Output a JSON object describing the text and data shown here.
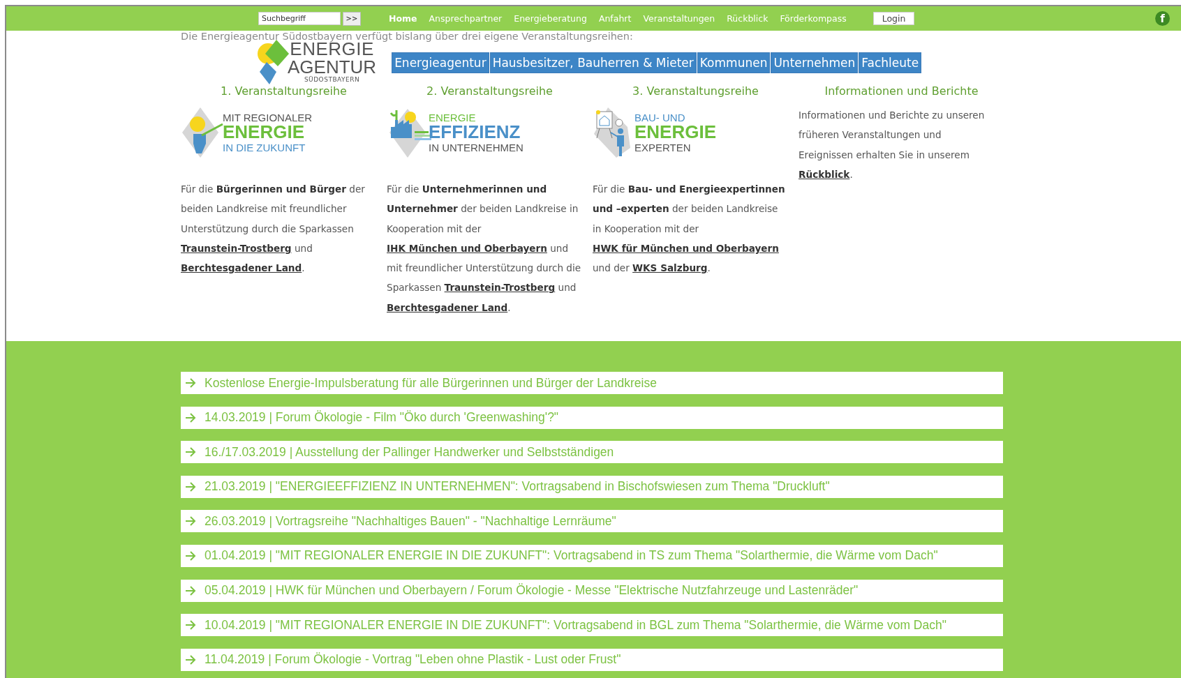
{
  "top_bar": {
    "search": {
      "placeholder": "Suchbegriff"
    },
    "search_button": ">>",
    "nav": [
      {
        "label": "Home",
        "selected": true
      },
      {
        "label": "Ansprechpartner",
        "selected": false
      },
      {
        "label": "Energieberatung",
        "selected": false
      },
      {
        "label": "Anfahrt",
        "selected": false
      },
      {
        "label": "Veranstaltungen",
        "selected": false
      },
      {
        "label": "Rückblick",
        "selected": false
      },
      {
        "label": "Förderkompass",
        "selected": false
      }
    ],
    "login": "Login",
    "facebook_glyph": "f"
  },
  "intro": "Die Energieagentur Südostbayern verfügt bislang über drei eigene Veranstaltungsreihen:",
  "logo": {
    "lines": [
      "ENERGIE",
      "AGENTUR",
      "SÜDOSTBAYERN"
    ]
  },
  "main_menu": [
    "Energieagentur",
    "Hausbesitzer, Bauherren & Mieter",
    "Kommunen",
    "Unternehmen",
    "Fachleute"
  ],
  "series_headings": [
    "1. Veranstaltungsreihe",
    "2. Veranstaltungsreihe",
    "3. Veranstaltungsreihe",
    "Informationen und Berichte"
  ],
  "columns": [
    {
      "kind": "hand",
      "logo_lines": [
        {
          "text": "MIT REGIONALER",
          "color": "#555555"
        },
        {
          "text": "ENERGIE",
          "color": "#6cbf3c"
        },
        {
          "text": "IN DIE ZUKUNFT",
          "color": "#4a90c8"
        }
      ],
      "text": [
        {
          "t": "Für die "
        },
        {
          "t": "Bürgerinnen und Bürger",
          "bold": true
        },
        {
          "t": " der beiden Landkreise mit freundlicher Unterstützung durch die Sparkassen "
        },
        {
          "t": "Traunstein-Trostberg",
          "link": true
        },
        {
          "t": " und "
        },
        {
          "t": "Berchtesgadener Land",
          "link": true
        },
        {
          "t": "."
        }
      ]
    },
    {
      "kind": "factory",
      "logo_lines": [
        {
          "text": "ENERGIE",
          "color": "#6cbf3c"
        },
        {
          "text": "EFFIZIENZ",
          "color": "#4a90c8"
        },
        {
          "text": "IN UNTERNEHMEN",
          "color": "#555555"
        }
      ],
      "text": [
        {
          "t": "Für die "
        },
        {
          "t": "Unternehmerinnen und Unternehmer",
          "bold": true
        },
        {
          "t": " der beiden Landkreise in Kooperation mit der "
        },
        {
          "t": "IHK München und Oberbayern",
          "link": true
        },
        {
          "t": " und mit freundlicher Unterstützung durch die Sparkassen "
        },
        {
          "t": "Traunstein-Trostberg",
          "link": true
        },
        {
          "t": " und "
        },
        {
          "t": "Berchtesgadener Land",
          "link": true
        },
        {
          "t": "."
        }
      ]
    },
    {
      "kind": "expert",
      "logo_lines": [
        {
          "text": "BAU- UND",
          "color": "#4a90c8"
        },
        {
          "text": "ENERGIE",
          "color": "#6cbf3c"
        },
        {
          "text": "EXPERTEN",
          "color": "#555555"
        }
      ],
      "text": [
        {
          "t": "Für die "
        },
        {
          "t": "Bau- und Energieexpertinnen und –experten",
          "bold": true
        },
        {
          "t": " der beiden Landkreise in Kooperation mit der "
        },
        {
          "t": "HWK für München und Oberbayern",
          "link": true
        },
        {
          "t": " und der "
        },
        {
          "t": "WKS Salzburg",
          "link": true
        },
        {
          "t": "."
        }
      ]
    },
    {
      "kind": "info",
      "text": [
        {
          "t": "Informationen und Berichte zu unseren früheren Veranstaltungen und Ereignissen erhalten Sie in unserem "
        },
        {
          "t": "Rückblick",
          "link": true
        },
        {
          "t": "."
        }
      ]
    }
  ],
  "events": [
    "Kostenlose Energie-Impulsberatung für alle Bürgerinnen und Bürger der Landkreise",
    "14.03.2019 | Forum Ökologie - Film \"Öko durch 'Greenwashing'?\"",
    "16./17.03.2019 | Ausstellung der Pallinger Handwerker und Selbstständigen",
    "21.03.2019 | \"ENERGIEEFFIZIENZ IN UNTERNEHMEN\": Vortragsabend in Bischofswiesen zum Thema \"Druckluft\"",
    "26.03.2019 | Vortragsreihe \"Nachhaltiges Bauen\" - \"Nachhaltige Lernräume\"",
    "01.04.2019 | \"MIT REGIONALER ENERGIE IN DIE ZUKUNFT\": Vortragsabend in TS zum Thema \"Solarthermie, die Wärme vom Dach\"",
    "05.04.2019 | HWK für München und Oberbayern / Forum Ökologie - Messe \"Elektrische Nutzfahrzeuge und Lastenräder\"",
    "10.04.2019 | \"MIT REGIONALER ENERGIE IN DIE ZUKUNFT\": Vortragsabend in BGL zum Thema \"Solarthermie, die Wärme vom Dach\"",
    "11.04.2019 | Forum Ökologie - Vortrag \"Leben ohne Plastik - Lust oder Frust\""
  ]
}
